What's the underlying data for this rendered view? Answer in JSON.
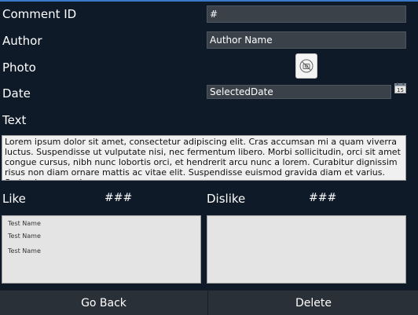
{
  "form": {
    "comment_id_label": "Comment ID",
    "comment_id_value": "#",
    "author_label": "Author",
    "author_value": "Author Name",
    "photo_label": "Photo",
    "date_label": "Date",
    "date_value": "SelectedDate",
    "text_label": "Text",
    "text_value": "Lorem ipsum dolor sit amet, consectetur adipiscing elit. Cras accumsan mi a quam viverra luctus. Suspendisse ut vulputate nisi, nec fermentum libero. Morbi sollicitudin, orci sit amet congue cursus, nibh nunc lobortis orci, et hendrerit arcu nunc a lorem. Curabitur dignissim risus non diam ornare mattis ac vitae elit. Suspendisse euismod gravida diam et varius. Sed quis commodo"
  },
  "icons": {
    "photo": "no-photo-icon",
    "calendar": "calendar-icon",
    "calendar_day": "15"
  },
  "votes": {
    "like_label": "Like",
    "like_count": "###",
    "dislike_label": "Dislike",
    "dislike_count": "###",
    "like_list": [
      "Test Name",
      "Test Name",
      "Test Name"
    ],
    "dislike_list": []
  },
  "buttons": {
    "back": "Go Back",
    "delete": "Delete"
  },
  "colors": {
    "background": "#0f1a29",
    "field": "#3a4149",
    "button_bar": "#2a3038",
    "accent": "#3a78c8"
  }
}
